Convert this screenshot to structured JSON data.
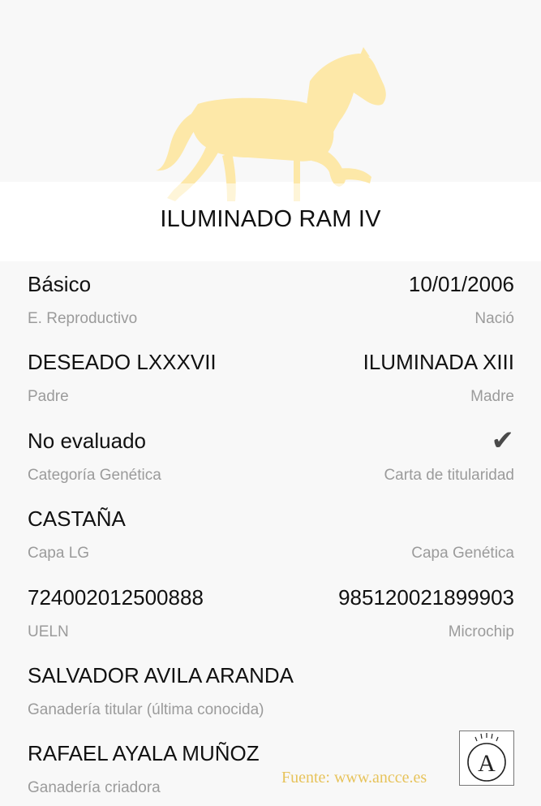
{
  "horse": {
    "name": "ILUMINADO RAM IV",
    "silhouette_icon": "horse-silhouette-icon",
    "silhouette_color": "#fde8a8"
  },
  "fields": [
    {
      "left": {
        "value": "Básico",
        "label": "E. Reproductivo"
      },
      "right": {
        "value": "10/01/2006",
        "label": "Nació"
      }
    },
    {
      "left": {
        "value": "DESEADO LXXXVII",
        "label": "Padre"
      },
      "right": {
        "value": "ILUMINADA XIII",
        "label": "Madre"
      }
    },
    {
      "left": {
        "value": "No evaluado",
        "label": "Categoría Genética"
      },
      "right": {
        "icon": "checkmark-icon",
        "label": "Carta de titularidad"
      }
    },
    {
      "left": {
        "value": "CASTAÑA",
        "label": "Capa LG"
      },
      "right": {
        "value": "",
        "label": "Capa Genética"
      }
    },
    {
      "left": {
        "value": "724002012500888",
        "label": "UELN"
      },
      "right": {
        "value": "985120021899903",
        "label": "Microchip"
      }
    },
    {
      "left": {
        "value": "SALVADOR AVILA ARANDA",
        "label": "Ganadería titular (última conocida)"
      }
    },
    {
      "left": {
        "value": "RAFAEL AYALA MUÑOZ",
        "label": "Ganadería criadora"
      }
    }
  ],
  "checkmark_glyph": "✔",
  "watermark": {
    "text": "Fuente: www.ancce.es",
    "color": "#e7c35b",
    "logo_letter": "A",
    "logo_icon": "ancce-logo-icon"
  },
  "colors": {
    "background": "#f8f8f8",
    "value_text": "#111111",
    "label_text": "#9b9b9b"
  }
}
